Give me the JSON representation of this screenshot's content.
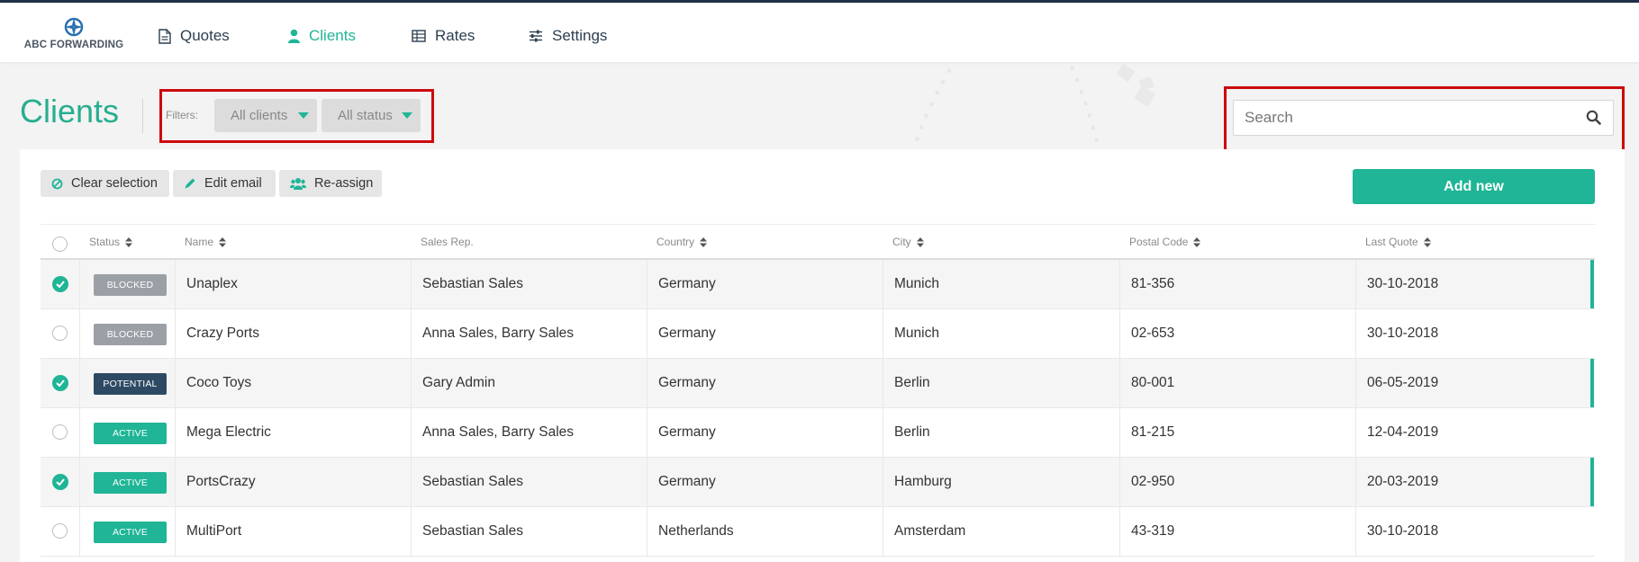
{
  "app": {
    "logo_text": "ABC FORWARDING"
  },
  "nav": {
    "items": [
      {
        "label": "Quotes",
        "icon": "document-icon",
        "active": false
      },
      {
        "label": "Clients",
        "icon": "user-icon",
        "active": true
      },
      {
        "label": "Rates",
        "icon": "table-icon",
        "active": false
      },
      {
        "label": "Settings",
        "icon": "sliders-icon",
        "active": false
      }
    ]
  },
  "page": {
    "title": "Clients"
  },
  "filters": {
    "label": "Filters:",
    "client_filter": "All clients",
    "status_filter": "All status"
  },
  "search": {
    "placeholder": "Search"
  },
  "actions": {
    "clear_selection": "Clear selection",
    "edit_email": "Edit email",
    "reassign": "Re-assign",
    "add_new": "Add new"
  },
  "table": {
    "headers": {
      "status": "Status",
      "name": "Name",
      "sales_rep": "Sales Rep.",
      "country": "Country",
      "city": "City",
      "postal_code": "Postal Code",
      "last_quote": "Last Quote"
    },
    "rows": [
      {
        "selected": true,
        "status": "BLOCKED",
        "status_type": "blocked",
        "name": "Unaplex",
        "sales_rep": "Sebastian Sales",
        "country": "Germany",
        "city": "Munich",
        "postal_code": "81-356",
        "last_quote": "30-10-2018"
      },
      {
        "selected": false,
        "status": "BLOCKED",
        "status_type": "blocked",
        "name": "Crazy Ports",
        "sales_rep": "Anna Sales, Barry Sales",
        "country": "Germany",
        "city": "Munich",
        "postal_code": "02-653",
        "last_quote": "30-10-2018"
      },
      {
        "selected": true,
        "status": "POTENTIAL",
        "status_type": "potential",
        "name": "Coco Toys",
        "sales_rep": "Gary Admin",
        "country": "Germany",
        "city": "Berlin",
        "postal_code": "80-001",
        "last_quote": "06-05-2019"
      },
      {
        "selected": false,
        "status": "ACTIVE",
        "status_type": "active",
        "name": "Mega Electric",
        "sales_rep": "Anna Sales, Barry Sales",
        "country": "Germany",
        "city": "Berlin",
        "postal_code": "81-215",
        "last_quote": "12-04-2019"
      },
      {
        "selected": true,
        "status": "ACTIVE",
        "status_type": "active",
        "name": "PortsCrazy",
        "sales_rep": "Sebastian Sales",
        "country": "Germany",
        "city": "Hamburg",
        "postal_code": "02-950",
        "last_quote": "20-03-2019"
      },
      {
        "selected": false,
        "status": "ACTIVE",
        "status_type": "active",
        "name": "MultiPort",
        "sales_rep": "Sebastian Sales",
        "country": "Netherlands",
        "city": "Amsterdam",
        "postal_code": "43-319",
        "last_quote": "30-10-2018"
      }
    ]
  },
  "colors": {
    "accent": "#1fb596",
    "title": "#27ad90",
    "nav_text": "#2c3e50",
    "blocked": "#9aa0a5",
    "potential": "#2e4963",
    "highlight_box": "#cc0a0a"
  }
}
